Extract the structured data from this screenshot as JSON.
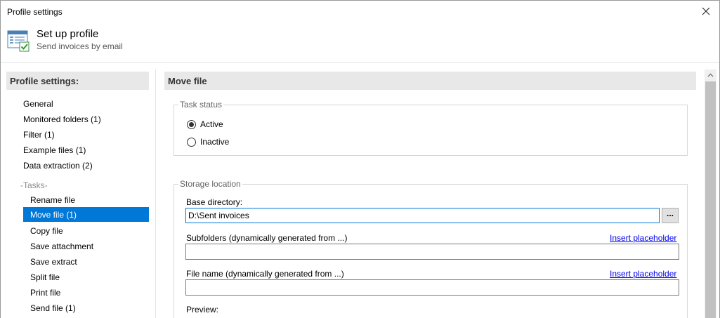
{
  "window": {
    "title": "Profile settings"
  },
  "header": {
    "title": "Set up profile",
    "subtitle": "Send invoices by email"
  },
  "sidebar": {
    "heading": "Profile settings:",
    "items": [
      "General",
      "Monitored folders (1)",
      "Filter (1)",
      "Example files (1)",
      "Data extraction (2)"
    ],
    "tasks_label": "-Tasks-",
    "tasks": [
      "Rename file",
      "Move file (1)",
      "Copy file",
      "Save attachment",
      "Save extract",
      "Split file",
      "Print file",
      "Send file (1)"
    ],
    "selected_task": "Move file (1)"
  },
  "main": {
    "title": "Move file",
    "task_status": {
      "legend": "Task status",
      "options": [
        "Active",
        "Inactive"
      ],
      "selected": "Active"
    },
    "storage": {
      "legend": "Storage location",
      "base_dir_label": "Base directory:",
      "base_dir_value": "D:\\Sent invoices",
      "browse_label": "...",
      "subfolders_label": "Subfolders (dynamically generated from ...)",
      "subfolders_value": "",
      "filename_label": "File name (dynamically generated from ...)",
      "filename_value": "",
      "insert_placeholder": "Insert placeholder",
      "preview_label": "Preview:"
    }
  },
  "colors": {
    "selection": "#0078d7",
    "link": "#0000ee",
    "section_bg": "#e8e8e8"
  },
  "icons": {
    "close": "close-icon",
    "profile": "profile-settings-icon",
    "scroll_up": "chevron-up-icon"
  }
}
